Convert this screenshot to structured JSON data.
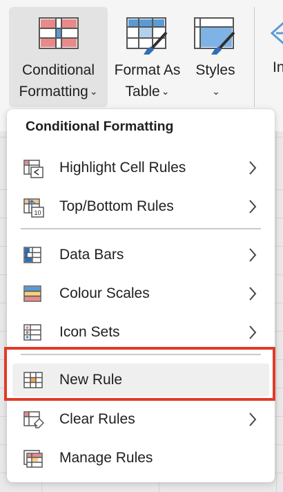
{
  "ribbon": {
    "conditional_formatting": {
      "line1": "Conditional",
      "line2": "Formatting",
      "chevron": "⌄"
    },
    "format_as_table": {
      "line1": "Format As",
      "line2": "Table",
      "chevron": "⌄"
    },
    "styles": {
      "line1": "Styles",
      "chevron": "⌄"
    },
    "cut_label": "In"
  },
  "menu": {
    "title": "Conditional Formatting",
    "items": [
      {
        "label": "Highlight Cell Rules",
        "icon": "highlight-cell-rules-icon",
        "submenu": true
      },
      {
        "label": "Top/Bottom Rules",
        "icon": "top-bottom-rules-icon",
        "submenu": true
      },
      {
        "label": "Data Bars",
        "icon": "data-bars-icon",
        "submenu": true
      },
      {
        "label": "Colour Scales",
        "icon": "colour-scales-icon",
        "submenu": true
      },
      {
        "label": "Icon Sets",
        "icon": "icon-sets-icon",
        "submenu": true
      },
      {
        "label": "New Rule",
        "icon": "new-rule-icon",
        "submenu": false,
        "highlighted": true
      },
      {
        "label": "Clear Rules",
        "icon": "clear-rules-icon",
        "submenu": true
      },
      {
        "label": "Manage Rules",
        "icon": "manage-rules-icon",
        "submenu": false
      }
    ],
    "icon_badge_top_bottom": "10"
  },
  "colors": {
    "highlight_border": "#e03a28",
    "hover_background": "#efefef",
    "accent_red": "#e88a8a",
    "accent_blue": "#5b9bd5"
  }
}
